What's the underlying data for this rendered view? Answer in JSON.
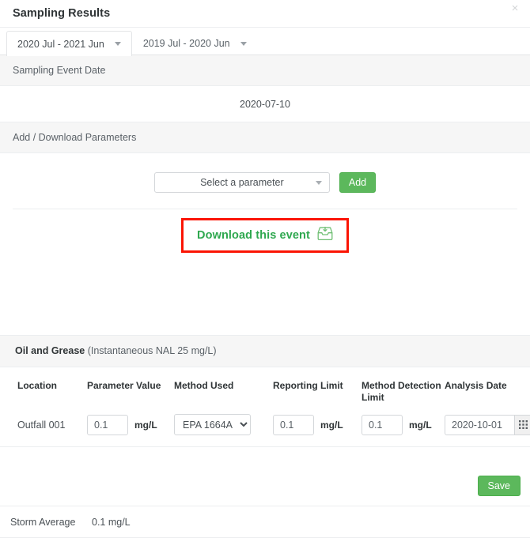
{
  "modal": {
    "title": "Sampling Results",
    "close_label": "×"
  },
  "tabs": [
    {
      "label": "2020 Jul - 2021 Jun",
      "active": true
    },
    {
      "label": "2019 Jul - 2020 Jun",
      "active": false
    }
  ],
  "sections": {
    "event_date_header": "Sampling Event Date",
    "event_date_value": "2020-07-10",
    "add_download_header": "Add / Download Parameters"
  },
  "add_parameter": {
    "select_value": "Select a parameter",
    "add_label": "Add"
  },
  "download": {
    "link_label": "Download this event",
    "icon": "inbox-download-icon",
    "highlight_color": "#fb1403",
    "link_color": "#2fa84f"
  },
  "parameter": {
    "name": "Oil and Grease",
    "note": "(Instantaneous NAL 25 mg/L)",
    "columns": [
      "Location",
      "Parameter Value",
      "Method Used",
      "Reporting Limit",
      "Method Detection Limit",
      "Analysis Date"
    ],
    "row": {
      "location": "Outfall 001",
      "parameter_value": "0.1",
      "parameter_value_unit": "mg/L",
      "method_used": "EPA 1664A",
      "method_used_options": [
        "EPA 1664A"
      ],
      "reporting_limit": "0.1",
      "reporting_limit_unit": "mg/L",
      "method_detection_limit": "0.1",
      "method_detection_limit_unit": "mg/L",
      "analysis_date": "2020-10-01",
      "calendar_icon": "calendar-grid-icon"
    },
    "save_label": "Save"
  },
  "storm_average": {
    "label": "Storm Average",
    "value": "0.1 mg/L"
  },
  "colors": {
    "green": "#5cb85c",
    "band": "#f6f6f6",
    "border": "#eceef0"
  }
}
